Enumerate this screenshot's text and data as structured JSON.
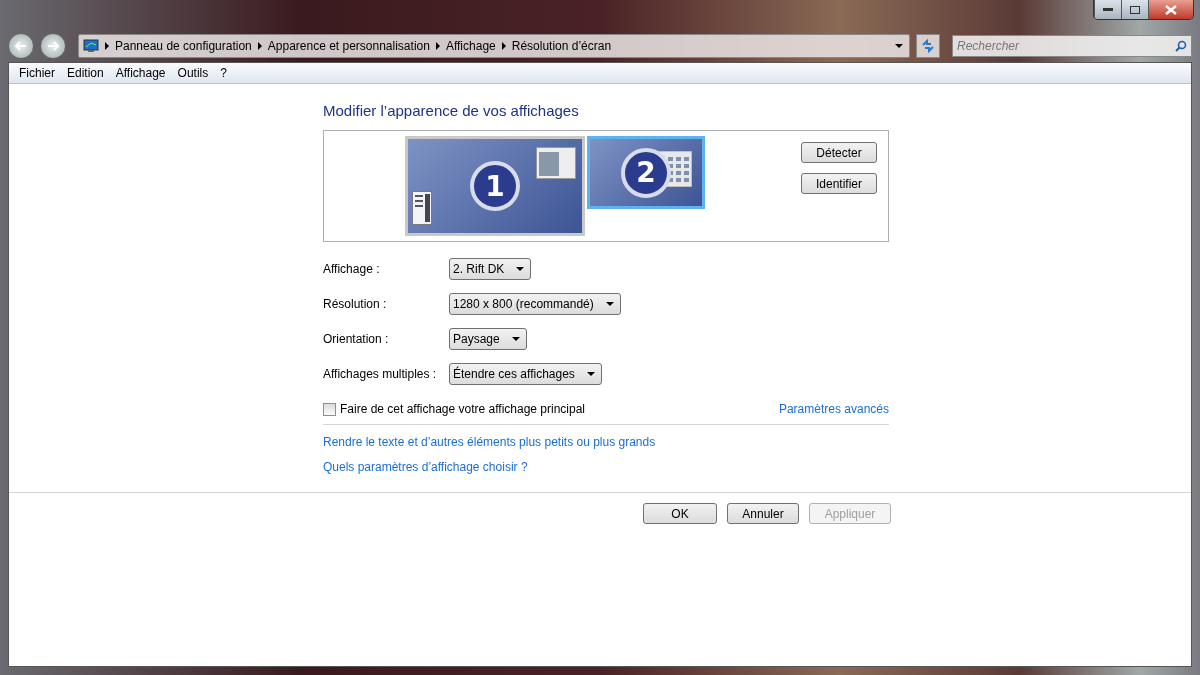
{
  "address_bar": {
    "path": [
      "Panneau de configuration",
      "Apparence et personnalisation",
      "Affichage",
      "Résolution d’écran"
    ]
  },
  "search": {
    "placeholder": "Rechercher"
  },
  "menu": [
    "Fichier",
    "Edition",
    "Affichage",
    "Outils",
    "?"
  ],
  "heading": "Modifier l’apparence de vos affichages",
  "monitors": [
    {
      "label": "1",
      "selected": false
    },
    {
      "label": "2",
      "selected": true
    }
  ],
  "side_buttons": [
    "Détecter",
    "Identifier"
  ],
  "fields": [
    {
      "label": "Affichage :",
      "value": "2. Rift DK"
    },
    {
      "label": "Résolution :",
      "value": "1280 x 800 (recommandé)"
    },
    {
      "label": "Orientation :",
      "value": "Paysage"
    },
    {
      "label": "Affichages multiples :",
      "value": "Étendre ces affichages"
    }
  ],
  "primary_checkbox": {
    "label": "Faire de cet affichage votre affichage principal",
    "checked": false
  },
  "advanced_link": "Paramètres avancés",
  "links": [
    "Rendre le texte et d’autres éléments plus petits ou plus grands",
    "Quels paramètres d’affichage choisir ?"
  ],
  "buttons": [
    {
      "label": "OK",
      "disabled": false
    },
    {
      "label": "Annuler",
      "disabled": false
    },
    {
      "label": "Appliquer",
      "disabled": true
    }
  ]
}
